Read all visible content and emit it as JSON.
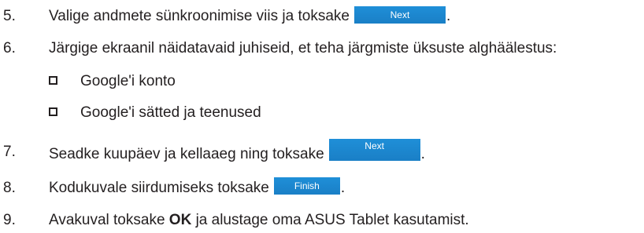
{
  "steps": [
    {
      "num": "5.",
      "text": "Valige andmete sünkroonimise viis ja toksake",
      "button": "Next",
      "after": "."
    },
    {
      "num": "6.",
      "text": "Järgige ekraanil näidatavaid juhiseid, et teha järgmiste üksuste alghäälestus:"
    },
    {
      "num": "7.",
      "text": "Seadke kuupäev ja kellaaeg ning toksake",
      "button": "Next",
      "after": "."
    },
    {
      "num": "8.",
      "text": "Kodukuvale siirdumiseks toksake",
      "button": "Finish",
      "after": "."
    },
    {
      "num": "9.",
      "text_before": "Avakuval toksake",
      "bold": "OK",
      "text_after": "ja alustage oma ASUS Tablet kasutamist."
    }
  ],
  "subitems": [
    "Google'i konto",
    "Google'i sätted ja teenused"
  ],
  "colors": {
    "text": "#231f20",
    "button": "#1a7fc6",
    "button_text": "#ffffff"
  }
}
